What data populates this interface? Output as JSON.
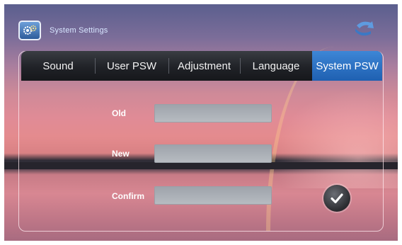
{
  "title": "System Settings",
  "icons": {
    "app": "settings-gears-icon",
    "back": "back-arrow-icon",
    "confirm": "checkmark-icon"
  },
  "tabs": [
    {
      "label": "Sound"
    },
    {
      "label": "User PSW"
    },
    {
      "label": "Adjustment"
    },
    {
      "label": "Language"
    },
    {
      "label": "System PSW",
      "active": true
    }
  ],
  "form": {
    "old": {
      "label": "Old",
      "value": ""
    },
    "new": {
      "label": "New",
      "value": ""
    },
    "confirm": {
      "label": "Confirm",
      "value": ""
    }
  },
  "colors": {
    "accent": "#2a6fc4",
    "tabbar": "#1e2024"
  }
}
